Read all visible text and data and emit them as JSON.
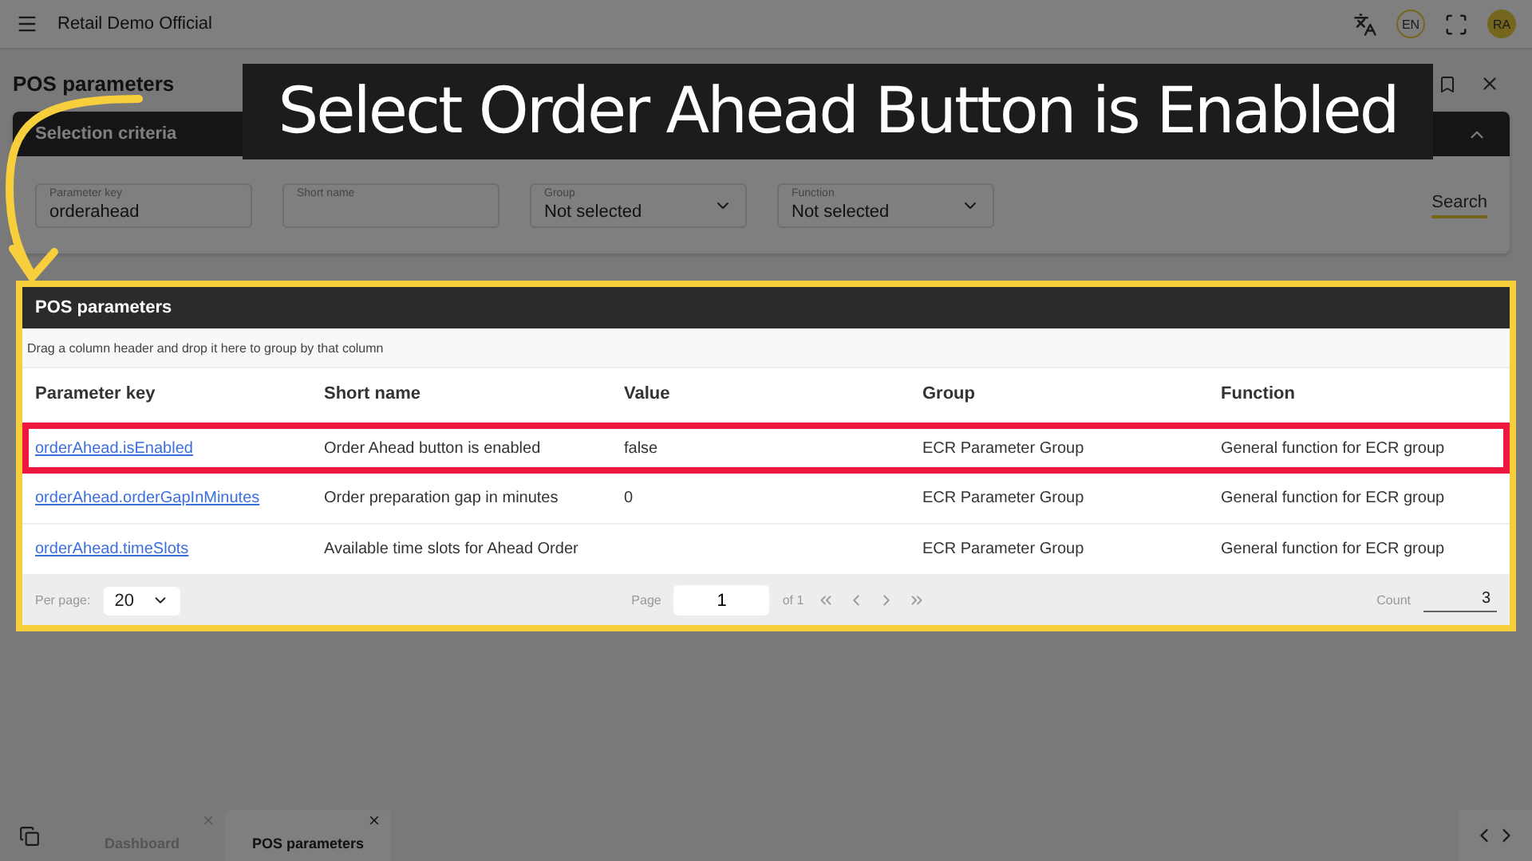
{
  "app": {
    "title": "Retail Demo Official",
    "language": "EN",
    "user_initials": "RA"
  },
  "page_title": "POS parameters",
  "overlay_caption": "Select Order Ahead Button is Enabled",
  "selection_criteria": {
    "title": "Selection criteria",
    "search_button": "Search",
    "fields": [
      {
        "kind": "text",
        "label": "Parameter key",
        "value": "orderahead"
      },
      {
        "kind": "text",
        "label": "Short name"
      },
      {
        "kind": "select",
        "label": "Group",
        "value": "Not selected"
      },
      {
        "kind": "select",
        "label": "Function",
        "value": "Not selected"
      }
    ]
  },
  "grid": {
    "title": "POS parameters",
    "group_hint": "Drag a column header and drop it here to group by that column",
    "columns": [
      "Parameter key",
      "Short name",
      "Value",
      "Group",
      "Function"
    ],
    "rows": [
      {
        "highlighted": true,
        "cells": [
          "orderAhead.isEnabled",
          "Order Ahead button is enabled",
          "false",
          "ECR Parameter Group",
          "General function for ECR group"
        ]
      },
      {
        "highlighted": false,
        "cells": [
          "orderAhead.orderGapInMinutes",
          "Order preparation gap in minutes",
          "0",
          "ECR Parameter Group",
          "General function for ECR group"
        ]
      },
      {
        "highlighted": false,
        "cells": [
          "orderAhead.timeSlots",
          "Available time slots for Ahead Order",
          "",
          "ECR Parameter Group",
          "General function for ECR group"
        ]
      }
    ],
    "footer": {
      "per_page_label": "Per page:",
      "per_page": "20",
      "page_label": "Page",
      "page": "1",
      "page_total": "of 1",
      "count_label": "Count",
      "count": "3"
    }
  },
  "tabs": [
    {
      "label": "Dashboard",
      "selected": false
    },
    {
      "label": "POS parameters",
      "selected": true
    }
  ]
}
